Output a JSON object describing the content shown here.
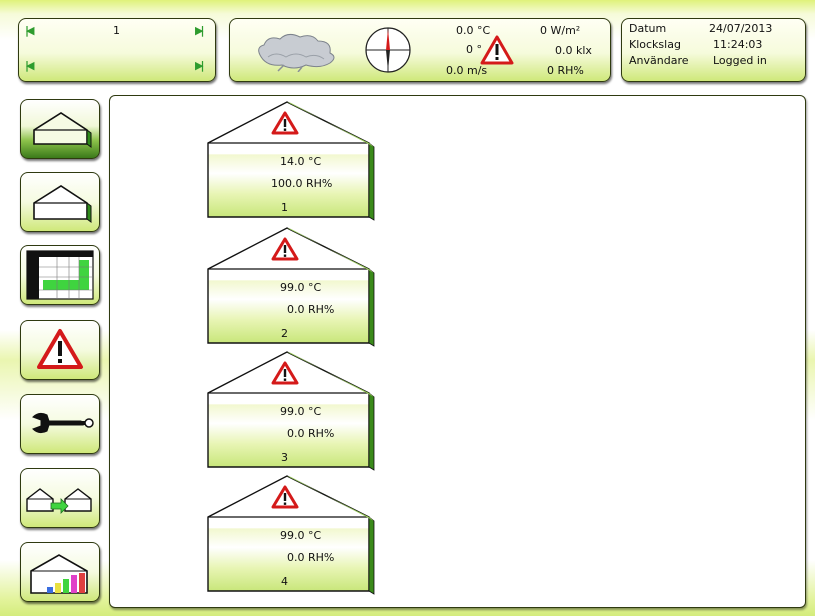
{
  "nav": {
    "page_number": "1"
  },
  "weather": {
    "temperature": "0.0 °C",
    "wind_direction": "0 °",
    "wind_speed": "0.0 m/s",
    "radiation": "0 W/m²",
    "light": "0.0 klx",
    "humidity": "0 RH%"
  },
  "info": {
    "date_label": "Datum",
    "date_value": "24/07/2013",
    "time_label": "Klockslag",
    "time_value": "11:24:03",
    "user_label": "Användare",
    "user_value": "Logged in"
  },
  "sidebar": {
    "items": [
      {
        "name": "overview"
      },
      {
        "name": "greenhouse"
      },
      {
        "name": "table"
      },
      {
        "name": "alarm"
      },
      {
        "name": "tools"
      },
      {
        "name": "transfer"
      },
      {
        "name": "statistics"
      }
    ]
  },
  "greenhouses": [
    {
      "temp": "14.0 °C",
      "rh": "100.0 RH%",
      "num": "1"
    },
    {
      "temp": "99.0 °C",
      "rh": "0.0 RH%",
      "num": "2"
    },
    {
      "temp": "99.0 °C",
      "rh": "0.0 RH%",
      "num": "3"
    },
    {
      "temp": "99.0 °C",
      "rh": "0.0 RH%",
      "num": "4"
    }
  ],
  "colors": {
    "accent_green": "#2e9c2e",
    "panel_green": "#cfe87a",
    "alarm_red": "#d41a1a"
  }
}
